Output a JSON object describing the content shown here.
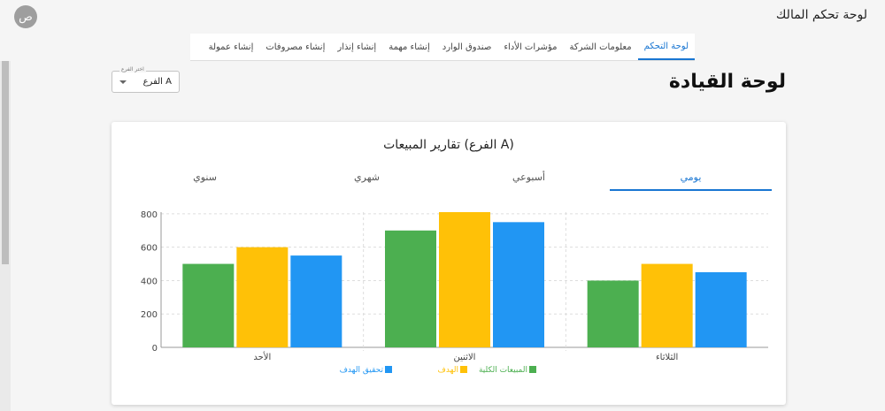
{
  "header": {
    "title": "لوحة تحكم المالك",
    "avatar_letter": "ص"
  },
  "nav": {
    "tabs": [
      {
        "label": "لوحة التحكم",
        "active": true
      },
      {
        "label": "معلومات الشركة",
        "active": false
      },
      {
        "label": "مؤشرات الأداء",
        "active": false
      },
      {
        "label": "صندوق الوارد",
        "active": false
      },
      {
        "label": "إنشاء مهمة",
        "active": false
      },
      {
        "label": "إنشاء إنذار",
        "active": false
      },
      {
        "label": "إنشاء مصروفات",
        "active": false
      },
      {
        "label": "إنشاء عمولة",
        "active": false
      }
    ]
  },
  "page": {
    "title": "لوحة القيادة",
    "branch_select": {
      "legend": "اختر الفرع",
      "value": "الفرع A"
    }
  },
  "card": {
    "title": "تقارير المبيعات (الفرع A)",
    "period_tabs": [
      {
        "label": "يومي",
        "active": true
      },
      {
        "label": "أسبوعي",
        "active": false
      },
      {
        "label": "شهري",
        "active": false
      },
      {
        "label": "سنوي",
        "active": false
      }
    ]
  },
  "chart_data": {
    "type": "bar",
    "categories": [
      "الأحد",
      "الاثنين",
      "الثلاثاء"
    ],
    "series": [
      {
        "name": "المبيعات الكلية",
        "color": "#4caf50",
        "values": [
          500,
          700,
          400
        ]
      },
      {
        "name": "الهدف",
        "color": "#ffc107",
        "values": [
          600,
          810,
          500
        ]
      },
      {
        "name": "تحقيق الهدف",
        "color": "#2196f3",
        "values": [
          550,
          750,
          450
        ]
      }
    ],
    "yticks": [
      0,
      200,
      400,
      600,
      800
    ],
    "ylim": [
      0,
      810
    ],
    "grid": true,
    "legend": "bottom"
  }
}
